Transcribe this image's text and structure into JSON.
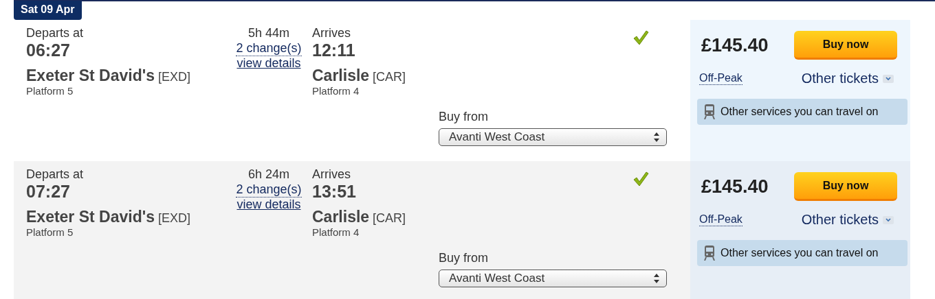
{
  "date_label": "Sat 09 Apr",
  "journeys": [
    {
      "depart_label": "Departs at",
      "depart_time": "06:27",
      "origin": "Exeter St David's",
      "origin_code": "[EXD]",
      "origin_platform": "Platform 5",
      "duration": "5h 44m",
      "changes": "2 change(s)",
      "details_link": "view details",
      "arrive_label": "Arrives",
      "arrive_time": "12:11",
      "destination": "Carlisle",
      "destination_code": "[CAR]",
      "destination_platform": "Platform 4",
      "available": true,
      "buy_from_label": "Buy from",
      "operator": "Avanti West Coast",
      "price": "£145.40",
      "buy_button": "Buy now",
      "ticket_type": "Off-Peak",
      "other_tickets": "Other tickets",
      "other_services": "Other services you can travel on"
    },
    {
      "depart_label": "Departs at",
      "depart_time": "07:27",
      "origin": "Exeter St David's",
      "origin_code": "[EXD]",
      "origin_platform": "Platform 5",
      "duration": "6h 24m",
      "changes": "2 change(s)",
      "details_link": "view details",
      "arrive_label": "Arrives",
      "arrive_time": "13:51",
      "destination": "Carlisle",
      "destination_code": "[CAR]",
      "destination_platform": "Platform 4",
      "available": true,
      "buy_from_label": "Buy from",
      "operator": "Avanti West Coast",
      "price": "£145.40",
      "buy_button": "Buy now",
      "ticket_type": "Off-Peak",
      "other_tickets": "Other tickets",
      "other_services": "Other services you can travel on"
    }
  ]
}
